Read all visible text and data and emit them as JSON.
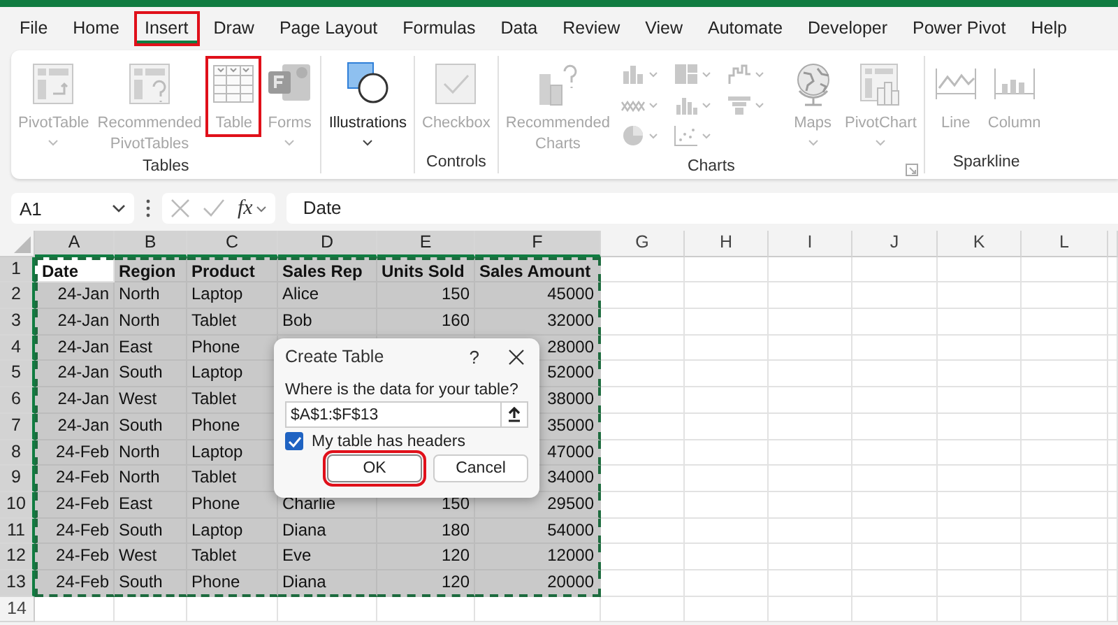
{
  "tabs": [
    {
      "label": "File",
      "selected": false,
      "highlighted": false
    },
    {
      "label": "Home",
      "selected": false,
      "highlighted": false
    },
    {
      "label": "Insert",
      "selected": true,
      "highlighted": true
    },
    {
      "label": "Draw",
      "selected": false,
      "highlighted": false
    },
    {
      "label": "Page Layout",
      "selected": false,
      "highlighted": false
    },
    {
      "label": "Formulas",
      "selected": false,
      "highlighted": false
    },
    {
      "label": "Data",
      "selected": false,
      "highlighted": false
    },
    {
      "label": "Review",
      "selected": false,
      "highlighted": false
    },
    {
      "label": "View",
      "selected": false,
      "highlighted": false
    },
    {
      "label": "Automate",
      "selected": false,
      "highlighted": false
    },
    {
      "label": "Developer",
      "selected": false,
      "highlighted": false
    },
    {
      "label": "Power Pivot",
      "selected": false,
      "highlighted": false
    },
    {
      "label": "Help",
      "selected": false,
      "highlighted": false
    }
  ],
  "ribbon": {
    "groups": [
      {
        "label": "Tables",
        "items": [
          {
            "kind": "pivottable",
            "lines": [
              "PivotTable"
            ],
            "caret": true,
            "disabled": true,
            "highlighted": false
          },
          {
            "kind": "recommended-pivottables",
            "lines": [
              "Recommended",
              "PivotTables"
            ],
            "disabled": true,
            "highlighted": false
          },
          {
            "kind": "table",
            "lines": [
              "Table"
            ],
            "disabled": true,
            "highlighted": true
          },
          {
            "kind": "forms",
            "lines": [
              "Forms"
            ],
            "caret": true,
            "disabled": true,
            "highlighted": false
          }
        ]
      },
      {
        "items": [
          {
            "kind": "illustrations",
            "lines": [
              "Illustrations"
            ],
            "caret": true,
            "disabled": false,
            "highlighted": false
          }
        ]
      },
      {
        "label": "Controls",
        "items": [
          {
            "kind": "checkbox",
            "lines": [
              "Checkbox"
            ],
            "disabled": true,
            "highlighted": false
          }
        ]
      },
      {
        "label": "Charts",
        "launcher": true,
        "items": [
          {
            "kind": "recommended-charts",
            "lines": [
              "Recommended",
              "Charts"
            ],
            "disabled": true,
            "highlighted": false
          },
          {
            "kind": "chart-gallery"
          },
          {
            "kind": "maps",
            "lines": [
              "Maps"
            ],
            "caret": true,
            "disabled": true,
            "highlighted": false
          },
          {
            "kind": "pivotchart",
            "lines": [
              "PivotChart"
            ],
            "caret": true,
            "disabled": true,
            "highlighted": false
          }
        ]
      },
      {
        "label": "Sparkline",
        "items": [
          {
            "kind": "sparkline-line",
            "lines": [
              "Line"
            ],
            "disabled": true,
            "highlighted": false
          },
          {
            "kind": "sparkline-column",
            "lines": [
              "Column"
            ],
            "disabled": true,
            "highlighted": false
          }
        ]
      }
    ]
  },
  "formula_bar": {
    "name_box": "A1",
    "function_label": "fx",
    "formula": "Date"
  },
  "sheet": {
    "columns": [
      {
        "letter": "A",
        "selected": true,
        "kind": "number"
      },
      {
        "letter": "B",
        "selected": true,
        "kind": "text"
      },
      {
        "letter": "C",
        "selected": true,
        "kind": "text"
      },
      {
        "letter": "D",
        "selected": true,
        "kind": "text"
      },
      {
        "letter": "E",
        "selected": true,
        "kind": "number"
      },
      {
        "letter": "F",
        "selected": true,
        "kind": "number"
      },
      {
        "letter": "G",
        "selected": false
      },
      {
        "letter": "H",
        "selected": false
      },
      {
        "letter": "I",
        "selected": false
      },
      {
        "letter": "J",
        "selected": false
      },
      {
        "letter": "K",
        "selected": false
      },
      {
        "letter": "L",
        "selected": false
      }
    ],
    "rows": [
      {
        "number": "1",
        "selected": true,
        "kind": "header",
        "cells": [
          "Date",
          "Region",
          "Product",
          "Sales Rep",
          "Units Sold",
          "Sales Amount"
        ]
      },
      {
        "number": "2",
        "selected": true,
        "kind": "data",
        "cells": [
          "24-Jan",
          "North",
          "Laptop",
          "Alice",
          "150",
          "45000"
        ]
      },
      {
        "number": "3",
        "selected": true,
        "kind": "data",
        "cells": [
          "24-Jan",
          "North",
          "Tablet",
          "Bob",
          "160",
          "32000"
        ]
      },
      {
        "number": "4",
        "selected": true,
        "kind": "data",
        "cells": [
          "24-Jan",
          "East",
          "Phone",
          null,
          null,
          "28000"
        ]
      },
      {
        "number": "5",
        "selected": true,
        "kind": "data",
        "cells": [
          "24-Jan",
          "South",
          "Laptop",
          null,
          null,
          "52000"
        ]
      },
      {
        "number": "6",
        "selected": true,
        "kind": "data",
        "cells": [
          "24-Jan",
          "West",
          "Tablet",
          null,
          null,
          "38000"
        ]
      },
      {
        "number": "7",
        "selected": true,
        "kind": "data",
        "cells": [
          "24-Jan",
          "South",
          "Phone",
          null,
          null,
          "35000"
        ]
      },
      {
        "number": "8",
        "selected": true,
        "kind": "data",
        "cells": [
          "24-Feb",
          "North",
          "Laptop",
          null,
          null,
          "47000"
        ]
      },
      {
        "number": "9",
        "selected": true,
        "kind": "data",
        "cells": [
          "24-Feb",
          "North",
          "Tablet",
          null,
          null,
          "34000"
        ]
      },
      {
        "number": "10",
        "selected": true,
        "kind": "data",
        "cells": [
          "24-Feb",
          "East",
          "Phone",
          "Charlie",
          "150",
          "29500"
        ]
      },
      {
        "number": "11",
        "selected": true,
        "kind": "data",
        "cells": [
          "24-Feb",
          "South",
          "Laptop",
          "Diana",
          "180",
          "54000"
        ]
      },
      {
        "number": "12",
        "selected": true,
        "kind": "data",
        "cells": [
          "24-Feb",
          "West",
          "Tablet",
          "Eve",
          "120",
          "12000"
        ]
      },
      {
        "number": "13",
        "selected": true,
        "kind": "data",
        "cells": [
          "24-Feb",
          "South",
          "Phone",
          "Diana",
          "120",
          "20000"
        ]
      },
      {
        "number": "14",
        "selected": false,
        "kind": "data",
        "cells": []
      }
    ]
  },
  "dialog": {
    "title": "Create Table",
    "help": "?",
    "prompt": "Where is the data for your table?",
    "range": "$A$1:$F$13",
    "headers_checkbox": {
      "label": "My table has headers",
      "checked": true
    },
    "buttons": [
      {
        "label": "OK",
        "highlighted": true
      },
      {
        "label": "Cancel",
        "highlighted": false
      }
    ]
  }
}
